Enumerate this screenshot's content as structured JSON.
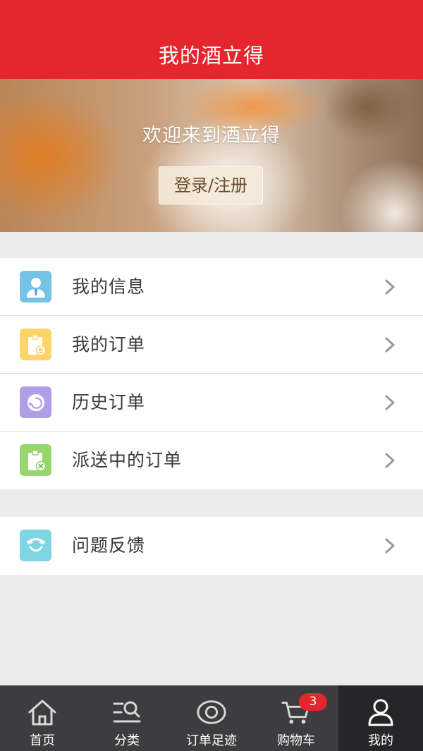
{
  "header": {
    "title": "我的酒立得"
  },
  "banner": {
    "welcome": "欢迎来到酒立得",
    "login_label": "登录/注册"
  },
  "menu_group_1": [
    {
      "label": "我的信息",
      "icon": "user-info-icon",
      "color": "#75c4e8"
    },
    {
      "label": "我的订单",
      "icon": "order-clipboard-icon",
      "color": "#fbd46a"
    },
    {
      "label": "历史订单",
      "icon": "history-icon",
      "color": "#b29ee6"
    },
    {
      "label": "派送中的订单",
      "icon": "delivery-order-icon",
      "color": "#97d66c"
    }
  ],
  "menu_group_2": [
    {
      "label": "问题反馈",
      "icon": "feedback-phone-icon",
      "color": "#7fd6e2"
    }
  ],
  "tabbar": {
    "tabs": [
      {
        "label": "首页",
        "icon": "home-icon"
      },
      {
        "label": "分类",
        "icon": "category-search-icon"
      },
      {
        "label": "订单足迹",
        "icon": "eye-icon"
      },
      {
        "label": "购物车",
        "icon": "cart-icon"
      },
      {
        "label": "我的",
        "icon": "profile-icon"
      }
    ],
    "active_index": 4,
    "cart_badge": "3"
  },
  "colors": {
    "brand_red": "#e5262f",
    "tabbar_bg": "#3d3d3f",
    "tabbar_active_bg": "#262628",
    "page_bg": "#ececec"
  }
}
